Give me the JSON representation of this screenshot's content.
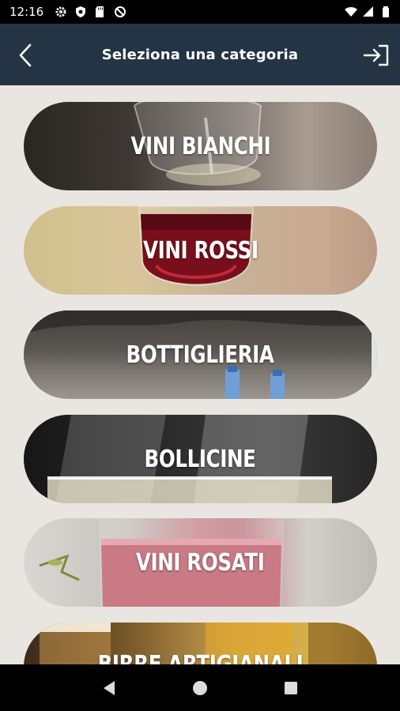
{
  "status_bar": {
    "time": "12:16",
    "left_icons": [
      "gear-icon",
      "shield-icon",
      "sd-card-icon",
      "no-signal-icon"
    ],
    "right_icons": [
      "wifi-icon",
      "cell-signal-icon",
      "battery-icon"
    ]
  },
  "app_bar": {
    "title": "Seleziona una categoria",
    "back_icon": "chevron-left-icon",
    "logout_icon": "logout-icon",
    "background": "#243444"
  },
  "categories": [
    {
      "label": "VINI BIANCHI"
    },
    {
      "label": "VINI ROSSI"
    },
    {
      "label": "BOTTIGLIERIA"
    },
    {
      "label": "BOLLICINE"
    },
    {
      "label": "VINI ROSATI"
    },
    {
      "label": "BIRRE ARTIGIANALI"
    }
  ],
  "nav_bar": {
    "buttons": [
      "back-triangle-icon",
      "home-circle-icon",
      "recents-square-icon"
    ]
  }
}
